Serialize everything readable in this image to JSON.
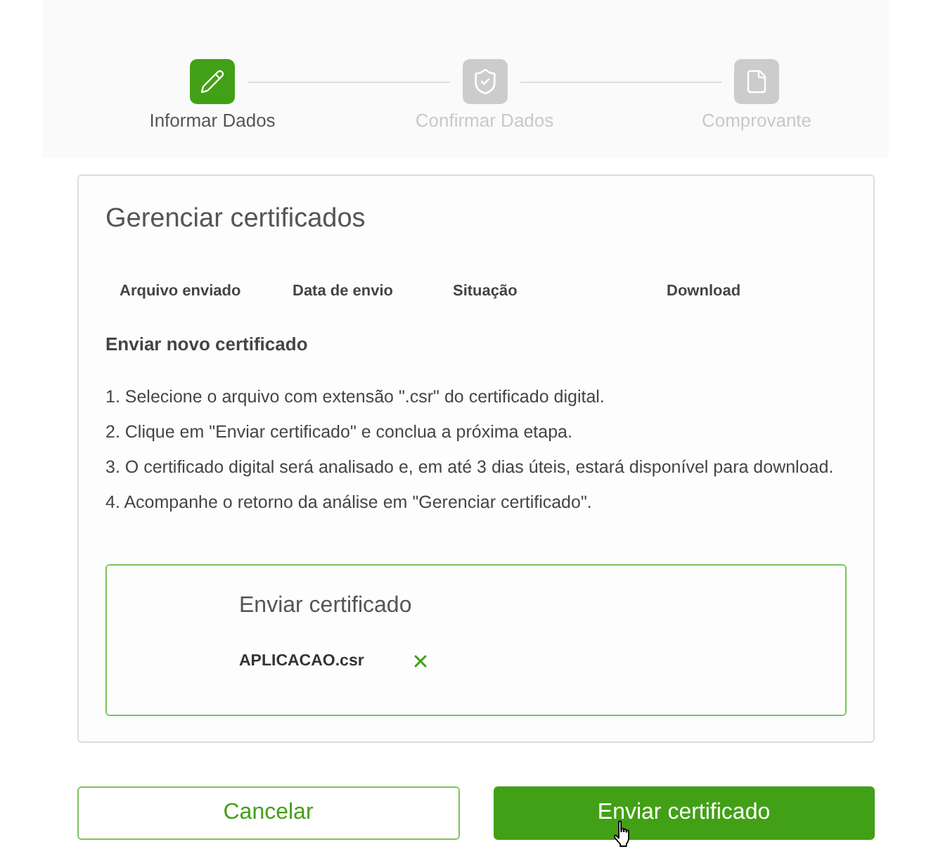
{
  "stepper": {
    "steps": [
      {
        "label": "Informar Dados",
        "kind": "pencil",
        "selected": true
      },
      {
        "label": "Confirmar Dados",
        "kind": "shield",
        "selected": false
      },
      {
        "label": "Comprovante",
        "kind": "document",
        "selected": false
      }
    ]
  },
  "card": {
    "title": "Gerenciar certificados",
    "table": {
      "columns": [
        "Arquivo enviado",
        "Data de envio",
        "Situação",
        "Download"
      ]
    },
    "section_title": "Enviar novo certificado",
    "instructions": [
      "1. Selecione o arquivo com extensão \".csr\" do certificado digital.",
      "2. Clique em \"Enviar certificado\" e conclua a próxima etapa.",
      "3. O certificado digital será analisado e, em até 3 dias úteis, estará disponível para download.",
      "4. Acompanhe o retorno da análise em \"Gerenciar certificado\"."
    ],
    "upload": {
      "title": "Enviar certificado",
      "file_name": "APLICACAO.csr"
    }
  },
  "buttons": [
    {
      "label": "Cancelar",
      "kind": "outline",
      "hovered": false
    },
    {
      "label": "Enviar certificado",
      "kind": "primary",
      "hovered": true
    }
  ]
}
